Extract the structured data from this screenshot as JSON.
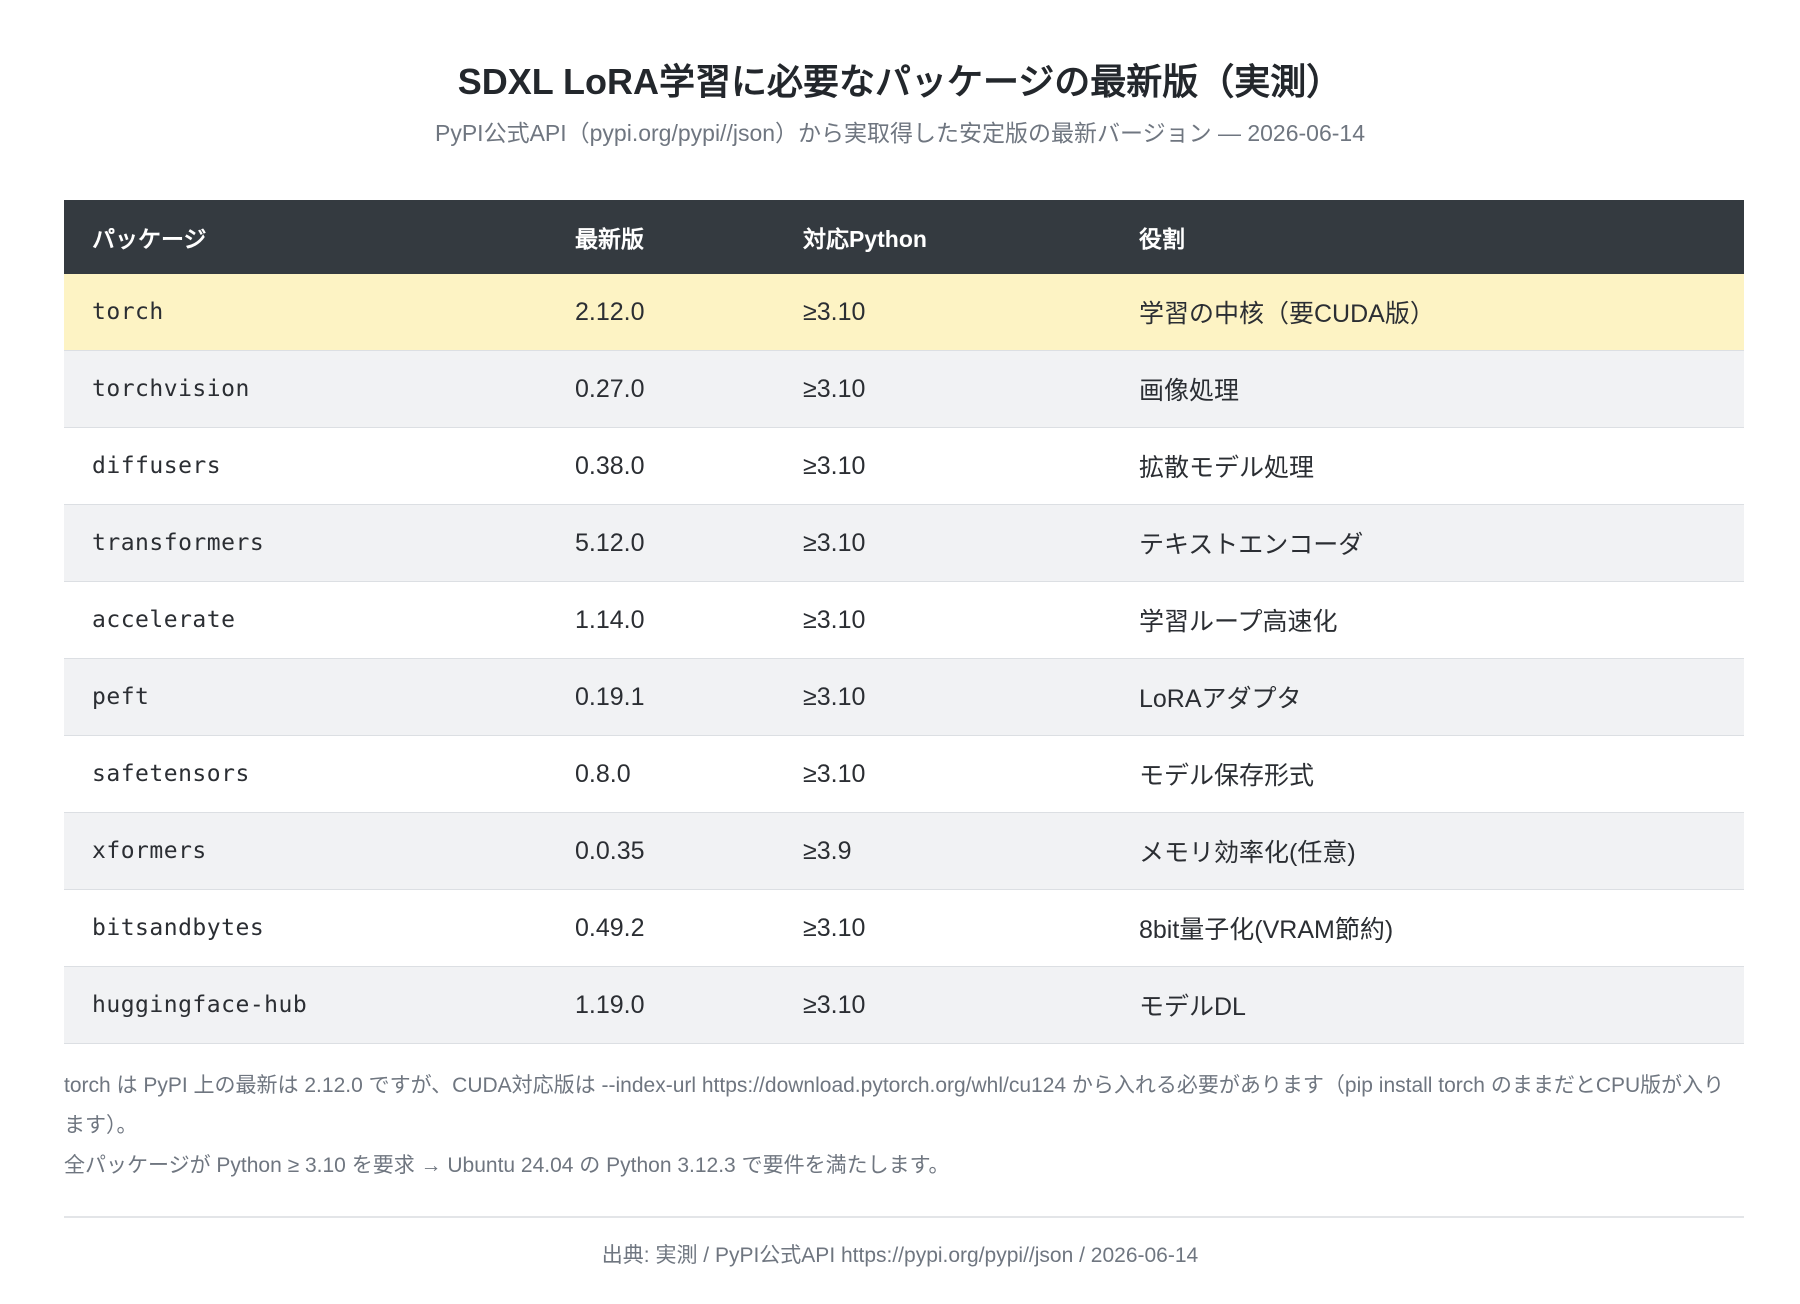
{
  "header": {
    "title": "SDXL LoRA学習に必要なパッケージの最新版（実測）",
    "subtitle": "PyPI公式API（pypi.org/pypi//json）から実取得した安定版の最新バージョン — 2026-06-14"
  },
  "table": {
    "columns": [
      "パッケージ",
      "最新版",
      "対応Python",
      "役割"
    ],
    "rows": [
      {
        "package": "torch",
        "version": "2.12.0",
        "python": "≥3.10",
        "role": "学習の中核（要CUDA版）",
        "highlighted": true
      },
      {
        "package": "torchvision",
        "version": "0.27.0",
        "python": "≥3.10",
        "role": "画像処理"
      },
      {
        "package": "diffusers",
        "version": "0.38.0",
        "python": "≥3.10",
        "role": "拡散モデル処理"
      },
      {
        "package": "transformers",
        "version": "5.12.0",
        "python": "≥3.10",
        "role": "テキストエンコーダ"
      },
      {
        "package": "accelerate",
        "version": "1.14.0",
        "python": "≥3.10",
        "role": "学習ループ高速化"
      },
      {
        "package": "peft",
        "version": "0.19.1",
        "python": "≥3.10",
        "role": "LoRAアダプタ"
      },
      {
        "package": "safetensors",
        "version": "0.8.0",
        "python": "≥3.10",
        "role": "モデル保存形式"
      },
      {
        "package": "xformers",
        "version": "0.0.35",
        "python": "≥3.9",
        "role": "メモリ効率化(任意)"
      },
      {
        "package": "bitsandbytes",
        "version": "0.49.2",
        "python": "≥3.10",
        "role": "8bit量子化(VRAM節約)"
      },
      {
        "package": "huggingface-hub",
        "version": "1.19.0",
        "python": "≥3.10",
        "role": "モデルDL"
      }
    ],
    "highlight_color": "#fdf3c4",
    "header_color": "#343a40"
  },
  "notes": [
    "torch は PyPI 上の最新は 2.12.0 ですが、CUDA対応版は --index-url https://download.pytorch.org/whl/cu124 から入れる必要があります（pip install torch のままだとCPU版が入ります）。",
    "全パッケージが Python ≥ 3.10 を要求 → Ubuntu 24.04 の Python 3.12.3 で要件を満たします。"
  ],
  "footer": {
    "source": "出典: 実測 / PyPI公式API https://pypi.org/pypi//json / 2026-06-14"
  }
}
